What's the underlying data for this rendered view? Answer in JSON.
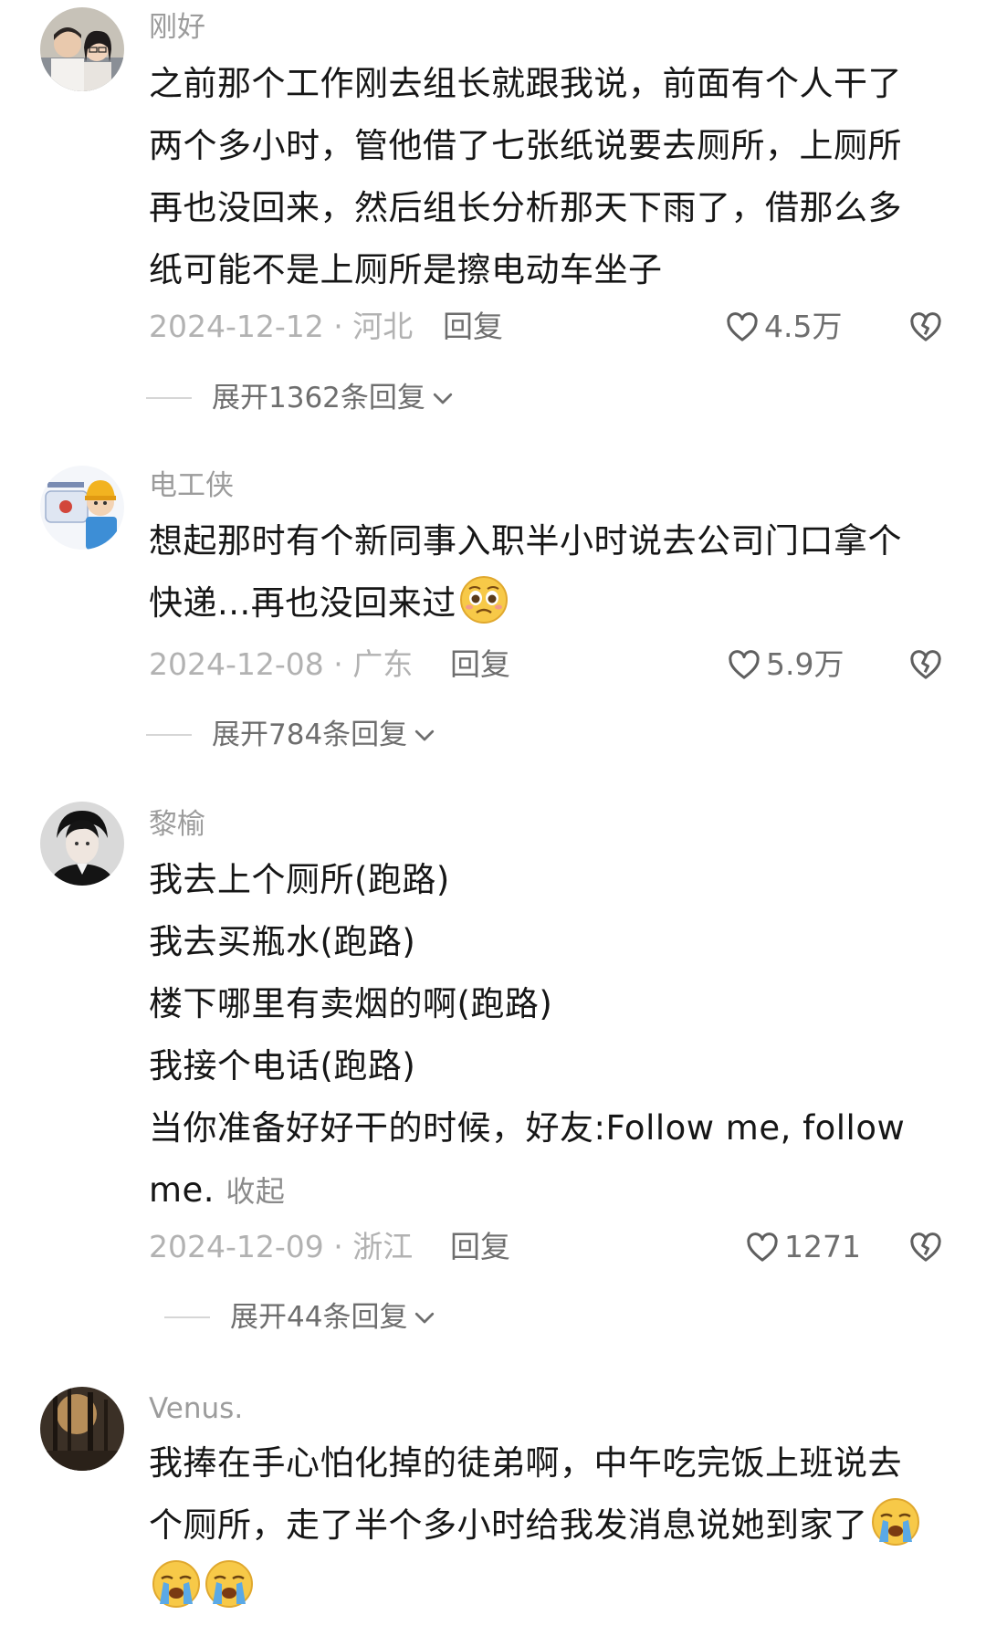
{
  "comments": [
    {
      "username": "刚好",
      "lines": [
        "之前那个工作刚去组长就跟我说，前面有个人干了",
        "两个多小时，管他借了七张纸说要去厕所，上厕所",
        "再也没回来，然后组长分析那天下雨了，借那么多",
        "纸可能不是上厕所是擦电动车坐子"
      ],
      "date_location": "2024-12-12 · 河北",
      "reply_label": "回复",
      "likes": "4.5万",
      "expand_label": "展开1362条回复"
    },
    {
      "username": "电工侠",
      "lines": [
        "想起那时有个新同事入职半小时说去公司门口拿个",
        "快递...再也没回来过"
      ],
      "emoji": "pleading-face-emoji",
      "date_location": "2024-12-08 · 广东",
      "reply_label": "回复",
      "likes": "5.9万",
      "expand_label": "展开784条回复"
    },
    {
      "username": "黎榆",
      "lines": [
        "我去上个厕所(跑路)",
        "我去买瓶水(跑路)",
        "楼下哪里有卖烟的啊(跑路)",
        "我接个电话(跑路)",
        "当你准备好好干的时候，好友:Follow me, follow",
        "me."
      ],
      "collapse_label": "收起",
      "date_location": "2024-12-09 · 浙江",
      "reply_label": "回复",
      "likes": "1271",
      "expand_label": "展开44条回复"
    },
    {
      "username": "Venus.",
      "lines": [
        "我捧在手心怕化掉的徒弟啊，中午吃完饭上班说去",
        "个厕所，走了半个多小时给我发消息说她到家了"
      ],
      "emoji": "crying-face-emoji"
    }
  ],
  "icons": {
    "like": "heart-outline-icon",
    "dislike": "broken-heart-icon",
    "expand": "chevron-down-icon"
  },
  "colors": {
    "text": "#161616",
    "muted": "#9c9c9c",
    "emoji_yellow": "#f7c948",
    "tear_blue": "#5aa9e6"
  }
}
